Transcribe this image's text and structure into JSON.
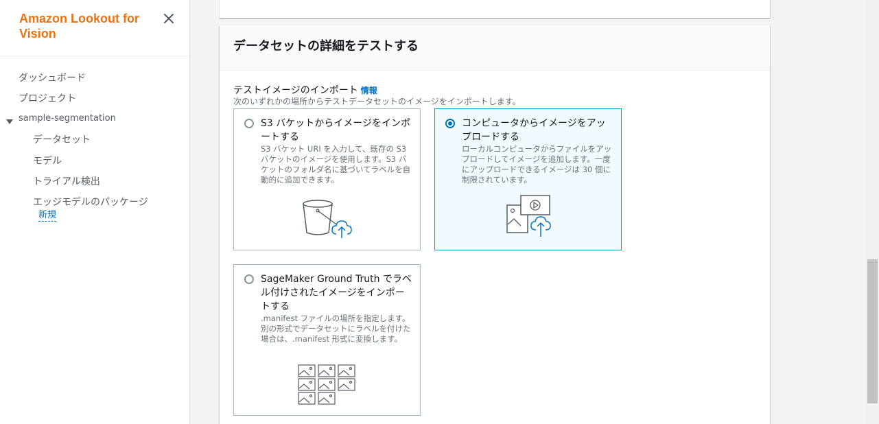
{
  "app": {
    "title": "Amazon Lookout for Vision"
  },
  "sidebar": {
    "items": [
      {
        "label": "ダッシュボード"
      },
      {
        "label": "プロジェクト"
      },
      {
        "label": "sample-segmentation"
      },
      {
        "label": "データセット"
      },
      {
        "label": "モデル"
      },
      {
        "label": "トライアル検出"
      },
      {
        "label": "エッジモデルのパッケージ"
      }
    ],
    "new_badge": "新規"
  },
  "section": {
    "title": "データセットの詳細をテストする",
    "field_label": "テストイメージのインポート",
    "info_link": "情報",
    "field_desc": "次のいずれかの場所からテストデータセットのイメージをインポートします。"
  },
  "options": [
    {
      "title": "S3 バケットからイメージをインポートする",
      "desc": "S3 バケット URI を入力して、既存の S3 バケットのイメージを使用します。S3 バケットのフォルダ名に基づいてラベルを自動的に追加できます。",
      "selected": false,
      "icon": "s3-bucket-upload-icon"
    },
    {
      "title": "コンピュータからイメージをアップロードする",
      "desc": "ローカルコンピュータからファイルをアップロードしてイメージを追加します。一度にアップロードできるイメージは 30 個に制限されています。",
      "selected": true,
      "icon": "computer-upload-icon"
    },
    {
      "title": "SageMaker Ground Truth でラベル付けされたイメージをインポートする",
      "desc": ".manifest ファイルの場所を指定します。別の形式でデータセットにラベルを付けた場合は、.manifest 形式に変換します。",
      "selected": false,
      "icon": "image-grid-icon"
    }
  ],
  "colors": {
    "brand": "#ec7211",
    "link": "#0073bb",
    "selected_border": "#00a1c9",
    "selected_bg": "#f1faff"
  }
}
